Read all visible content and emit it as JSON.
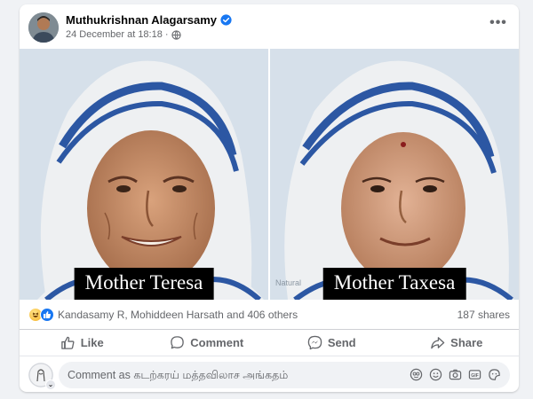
{
  "post": {
    "author": "Muthukrishnan Alagarsamy",
    "timestamp": "24 December at 18:18",
    "separator": "·",
    "privacy_icon": "globe-icon",
    "verified_icon": "verified-badge-icon",
    "more_icon": "more-options-icon"
  },
  "images": [
    {
      "caption": "Mother Teresa"
    },
    {
      "caption": "Mother Taxesa",
      "watermark": "Natural"
    }
  ],
  "reactions": {
    "icons": [
      "haha-reaction-icon",
      "like-reaction-icon"
    ],
    "summary": "Kandasamy R, Mohiddeen Harsath and 406 others",
    "shares": "187 shares"
  },
  "actions": [
    {
      "label": "Like",
      "icon": "thumbs-up-icon"
    },
    {
      "label": "Comment",
      "icon": "speech-bubble-icon"
    },
    {
      "label": "Send",
      "icon": "messenger-icon"
    },
    {
      "label": "Share",
      "icon": "share-arrow-icon"
    }
  ],
  "comment": {
    "placeholder": "Comment as கடற்கரய் மத்தவிலாச அங்கதம்",
    "tool_icons": [
      "avatar-sticker-icon",
      "emoji-icon",
      "camera-icon",
      "gif-icon",
      "sticker-icon"
    ]
  },
  "colors": {
    "background": "#f0f2f5",
    "card": "#ffffff",
    "accent": "#1877f2",
    "secondary_text": "#65676b"
  }
}
